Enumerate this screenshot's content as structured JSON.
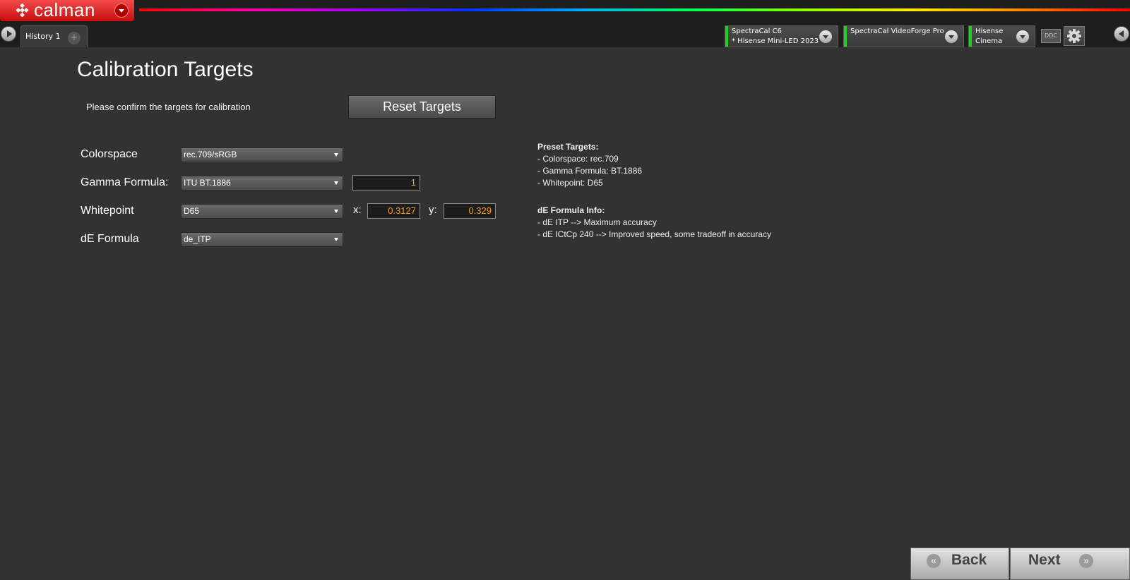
{
  "app": {
    "brand": "calman",
    "brand_color": "#e11b1b"
  },
  "tabs": [
    {
      "label": "History 1"
    }
  ],
  "tab_add_label": "+",
  "devices": [
    {
      "line1": "SpectraCal C6",
      "line2": "* Hisense Mini-LED 2023",
      "status_color": "#20d020"
    },
    {
      "line1": "SpectraCal VideoForge Pro",
      "line2": "",
      "status_color": "#20d020"
    },
    {
      "line1": "Hisense",
      "line2": "Cinema",
      "status_color": "#20d020"
    }
  ],
  "ddc_label": "DDC",
  "page": {
    "title": "Calibration Targets",
    "confirm_text": "Please confirm the targets for calibration",
    "reset_button": "Reset Targets"
  },
  "form": {
    "colorspace": {
      "label": "Colorspace",
      "value": "rec.709/sRGB"
    },
    "gamma": {
      "label": "Gamma Formula:",
      "value": "ITU BT.1886",
      "input_value": "1"
    },
    "whitepoint": {
      "label": "Whitepoint",
      "value": "D65",
      "x_label": "x:",
      "x_value": "0.3127",
      "y_label": "y:",
      "y_value": "0.329"
    },
    "de_formula": {
      "label": "dE Formula",
      "value": "de_ITP"
    }
  },
  "info": {
    "preset_heading": "Preset Targets:",
    "preset_lines": [
      "- Colorspace:  rec.709",
      "- Gamma Formula:  BT.1886",
      "- Whitepoint:  D65"
    ],
    "de_heading": "dE Formula Info:",
    "de_lines": [
      "- dE ITP --> Maximum accuracy",
      "- dE ICtCp 240 --> Improved speed, some tradeoff in accuracy"
    ]
  },
  "nav": {
    "back": "Back",
    "next": "Next"
  },
  "icons": {
    "logo": "calman-diamond-logo-icon",
    "gear": "gear-icon",
    "play": "play-icon",
    "collapse": "chevron-left-icon"
  }
}
